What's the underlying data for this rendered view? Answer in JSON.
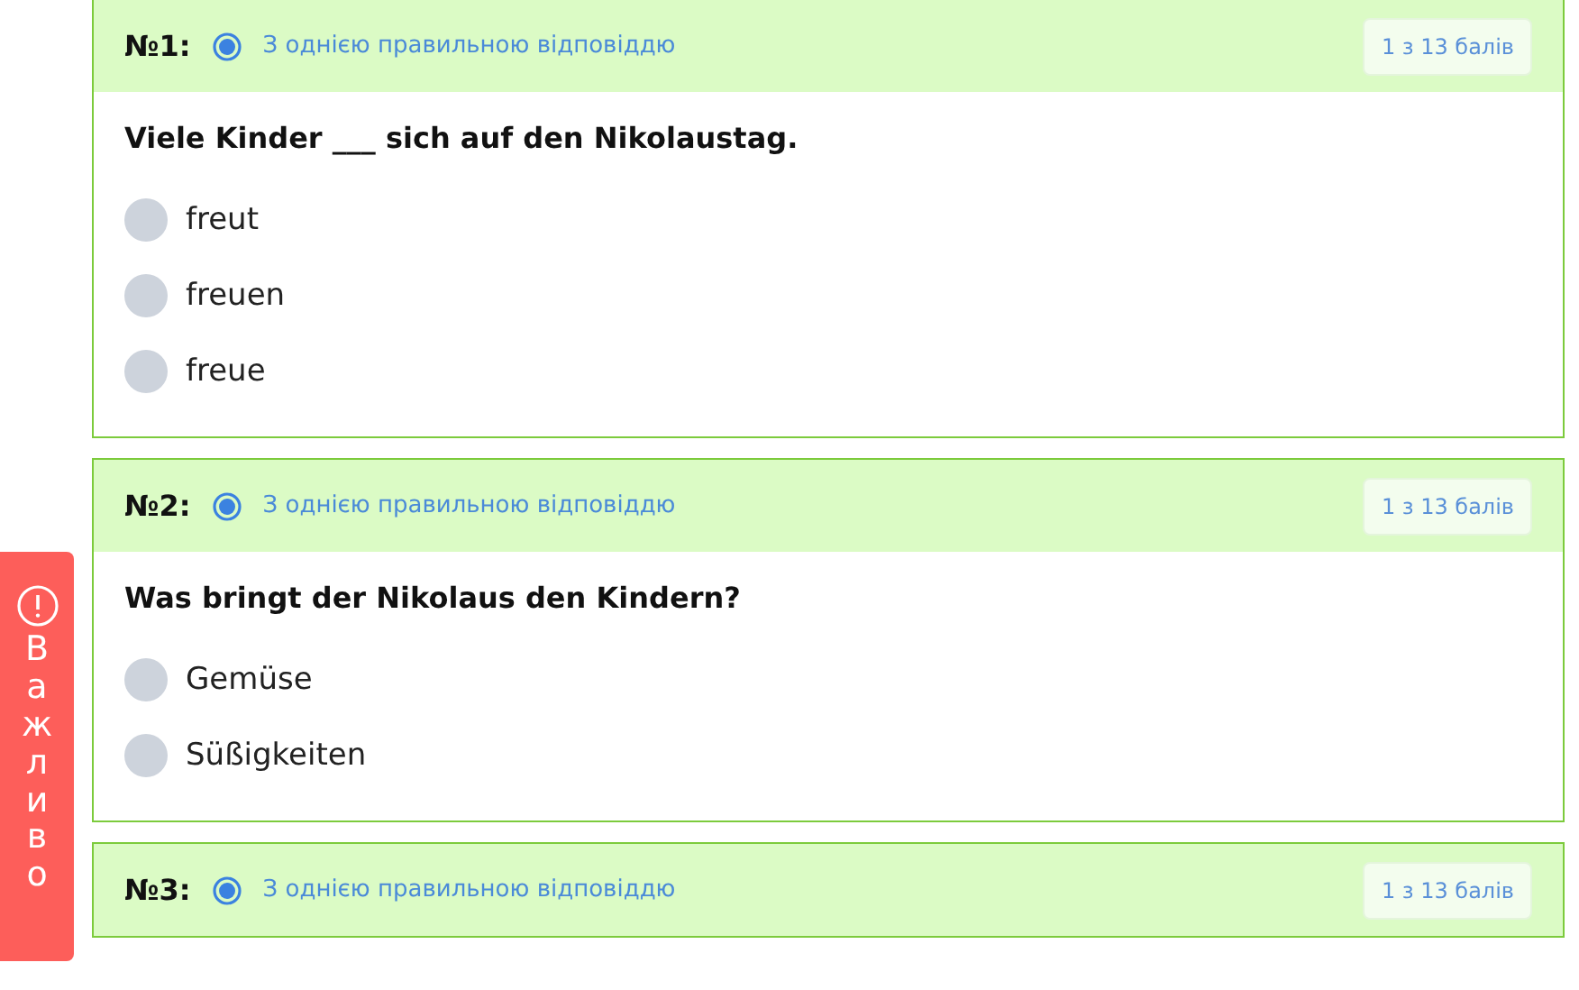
{
  "questions": [
    {
      "number": "№1:",
      "type": "З однією правильною відповіддю",
      "points": "1 з 13 балів",
      "text": "Viele Kinder ___ sich auf den Nikolaustag.",
      "options": [
        {
          "label": "freut",
          "selected": false
        },
        {
          "label": "freuen",
          "selected": false
        },
        {
          "label": "freue",
          "selected": false
        }
      ]
    },
    {
      "number": "№2:",
      "type": "З однією правильною відповіддю",
      "points": "1 з 13 балів",
      "text": "Was bringt der Nikolaus den Kindern?",
      "options": [
        {
          "label": "Gemüse",
          "selected": false
        },
        {
          "label": "Süßigkeiten",
          "selected": false
        }
      ]
    },
    {
      "number": "№3:",
      "type": "З однією правильною відповіддю",
      "points": "1 з 13 балів"
    }
  ],
  "side_tab": {
    "label": "Важливо"
  }
}
